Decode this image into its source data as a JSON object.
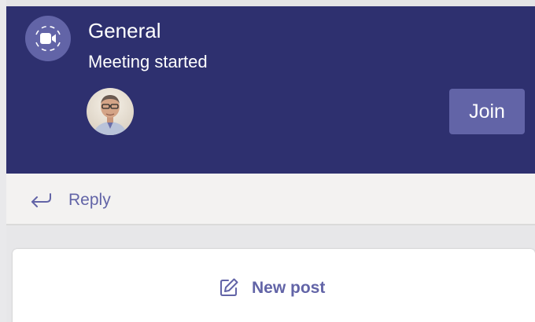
{
  "colors": {
    "card_background": "#2e306f",
    "accent": "#6264a7",
    "reply_bar": "#f3f2f1",
    "page_background": "#e7e7e9"
  },
  "meeting": {
    "icon": "video-camera-icon",
    "title": "General",
    "status": "Meeting started",
    "participant_avatar": "participant-avatar",
    "join_label": "Join"
  },
  "reply": {
    "icon": "reply-arrow-icon",
    "label": "Reply"
  },
  "new_post": {
    "icon": "compose-icon",
    "label": "New post"
  }
}
